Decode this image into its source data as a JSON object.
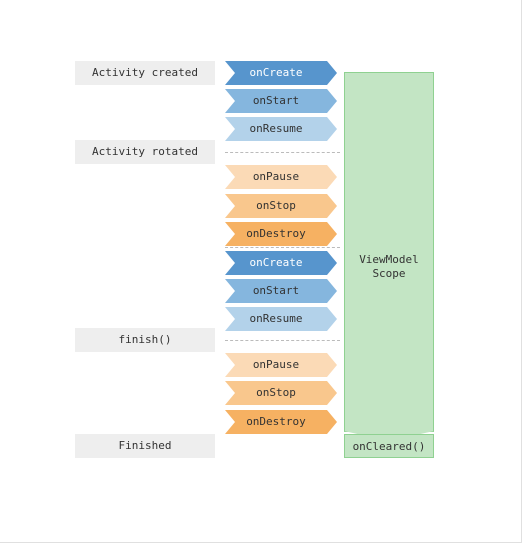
{
  "events": {
    "created": "Activity created",
    "rotated": "Activity rotated",
    "finish": "finish()",
    "finished": "Finished"
  },
  "lifecycle": {
    "onCreate": "onCreate",
    "onStart": "onStart",
    "onResume": "onResume",
    "onPause": "onPause",
    "onStop": "onStop",
    "onDestroy": "onDestroy"
  },
  "viewmodel": {
    "scope": "ViewModel\nScope",
    "onCleared": "onCleared()"
  }
}
